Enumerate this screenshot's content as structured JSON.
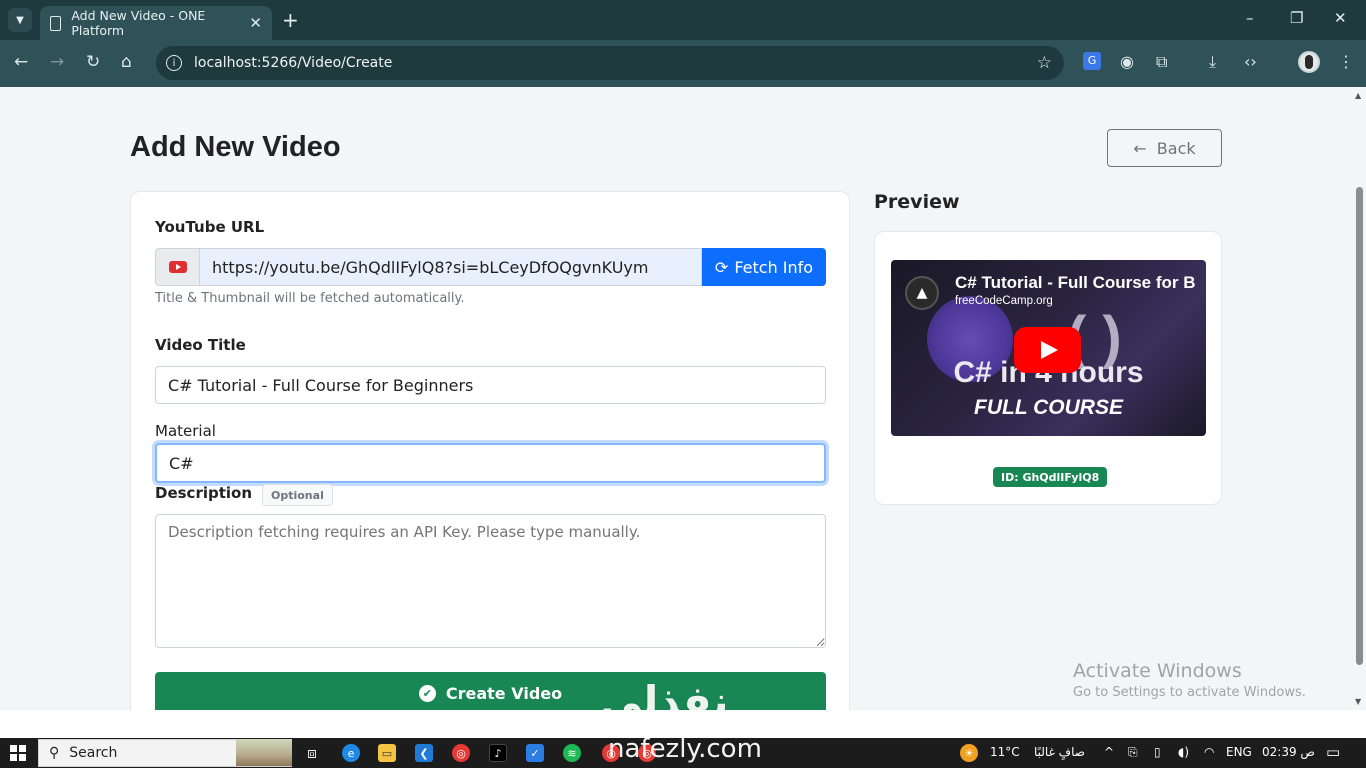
{
  "browser": {
    "tab_title": "Add New Video - ONE Platform",
    "tab_close": "✕",
    "new_tab": "+",
    "url": "localhost:5266/Video/Create",
    "window_controls": [
      "–",
      "❐",
      "✕"
    ]
  },
  "page": {
    "heading": "Add New Video",
    "back_label": "Back",
    "youtube_url_label": "YouTube URL",
    "youtube_url_value": "https://youtu.be/GhQdlIFylQ8?si=bLCeyDfOQgvnKUym",
    "fetch_label": "Fetch Info",
    "url_help": "Title & Thumbnail will be fetched automatically.",
    "video_title_label": "Video Title",
    "video_title_value": "C# Tutorial - Full Course for Beginners",
    "material_label": "Material",
    "material_value": "C#",
    "description_label": "Description",
    "optional_badge": "Optional",
    "description_placeholder": "Description fetching requires an API Key. Please type manually.",
    "create_label": "Create Video"
  },
  "preview": {
    "heading": "Preview",
    "video_title": "C# Tutorial - Full Course for B",
    "channel": "freeCodeCamp.org",
    "thumb_line1": "C# in 4 hours",
    "thumb_line2": "FULL COURSE",
    "id_badge": "ID: GhQdlIFylQ8"
  },
  "watermark": {
    "line1": "Activate Windows",
    "line2": "Go to Settings to activate Windows."
  },
  "overlay": {
    "brand_ar": "نفذلي",
    "brand_en": "nafezly.com"
  },
  "taskbar": {
    "search_label": "Search",
    "temperature": "11°C",
    "weather": "صافٍ غالبًا",
    "language": "ENG",
    "time": "02:39 ص"
  },
  "colors": {
    "primary": "#0d6efd",
    "success": "#198754",
    "chrome_dark": "#1f3a3f",
    "chrome_toolbar": "#2f5258"
  }
}
